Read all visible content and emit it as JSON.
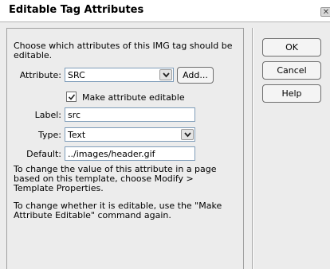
{
  "window": {
    "title": "Editable Tag Attributes"
  },
  "instructions": "Choose which attributes of this IMG tag should be editable.",
  "attribute": {
    "label": "Attribute:",
    "selected": "SRC",
    "add_button": "Add..."
  },
  "make_editable": {
    "label": "Make attribute editable",
    "checked": true
  },
  "label_field": {
    "label": "Label:",
    "value": "src"
  },
  "type_field": {
    "label": "Type:",
    "selected": "Text"
  },
  "default_field": {
    "label": "Default:",
    "value": "../images/header.gif"
  },
  "help_text_1": "To change the value of this attribute in a page based on this template, choose Modify > Template Properties.",
  "help_text_2": "To change whether it is editable, use the \"Make Attribute Editable\" command again.",
  "buttons": {
    "ok": "OK",
    "cancel": "Cancel",
    "help": "Help"
  },
  "icons": {
    "close": "close-icon",
    "dropdown": "chevron-down-icon",
    "checkbox": "checkmark-icon"
  }
}
